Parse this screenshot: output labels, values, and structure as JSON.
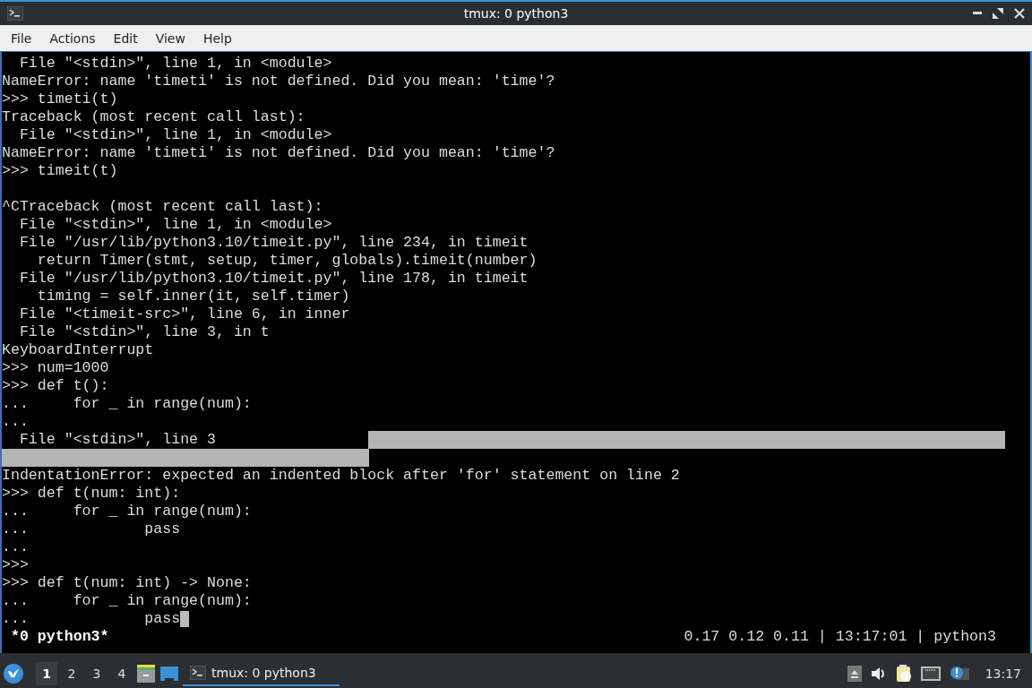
{
  "window": {
    "title": "tmux: 0 python3"
  },
  "menu": [
    "File",
    "Actions",
    "Edit",
    "View",
    "Help"
  ],
  "terminal": {
    "lines": [
      {
        "kind": "text",
        "text": "  File \"<stdin>\", line 1, in <module>"
      },
      {
        "kind": "text",
        "text": "NameError: name 'timeti' is not defined. Did you mean: 'time'?"
      },
      {
        "kind": "text",
        "text": ">>> timeti(t)"
      },
      {
        "kind": "text",
        "text": "Traceback (most recent call last):"
      },
      {
        "kind": "text",
        "text": "  File \"<stdin>\", line 1, in <module>"
      },
      {
        "kind": "text",
        "text": "NameError: name 'timeti' is not defined. Did you mean: 'time'?"
      },
      {
        "kind": "text",
        "text": ">>> timeit(t)"
      },
      {
        "kind": "blank"
      },
      {
        "kind": "text",
        "text": "^CTraceback (most recent call last):"
      },
      {
        "kind": "text",
        "text": "  File \"<stdin>\", line 1, in <module>"
      },
      {
        "kind": "text",
        "text": "  File \"/usr/lib/python3.10/timeit.py\", line 234, in timeit"
      },
      {
        "kind": "text",
        "text": "    return Timer(stmt, setup, timer, globals).timeit(number)"
      },
      {
        "kind": "text",
        "text": "  File \"/usr/lib/python3.10/timeit.py\", line 178, in timeit"
      },
      {
        "kind": "text",
        "text": "    timing = self.inner(it, self.timer)"
      },
      {
        "kind": "text",
        "text": "  File \"<timeit-src>\", line 6, in inner"
      },
      {
        "kind": "text",
        "text": "  File \"<stdin>\", line 3, in t"
      },
      {
        "kind": "text",
        "text": "KeyboardInterrupt"
      },
      {
        "kind": "text",
        "text": ">>> num=1000"
      },
      {
        "kind": "text",
        "text": ">>> def t():"
      },
      {
        "kind": "text",
        "text": "...     for _ in range(num):"
      },
      {
        "kind": "text",
        "text": "..."
      },
      {
        "kind": "selection-tail",
        "text": "  File \"<stdin>\", line 3"
      },
      {
        "kind": "selection-head"
      },
      {
        "kind": "text",
        "text": "IndentationError: expected an indented block after 'for' statement on line 2"
      },
      {
        "kind": "text",
        "text": ">>> def t(num: int):"
      },
      {
        "kind": "text",
        "text": "...     for _ in range(num):"
      },
      {
        "kind": "text",
        "text": "...             pass"
      },
      {
        "kind": "text",
        "text": "..."
      },
      {
        "kind": "text",
        "text": ">>>"
      },
      {
        "kind": "text",
        "text": ">>> def t(num: int) -> None:"
      },
      {
        "kind": "text",
        "text": "...     for _ in range(num):"
      },
      {
        "kind": "cursor",
        "text": "...             pass"
      }
    ],
    "status_left": "*0 python3*",
    "status_right": "0.17 0.12 0.11 | 13:17:01 | python3"
  },
  "taskbar": {
    "workspaces": [
      {
        "label": "1",
        "selected": true
      },
      {
        "label": "2",
        "selected": false
      },
      {
        "label": "3",
        "selected": false
      },
      {
        "label": "4",
        "selected": false
      }
    ],
    "task": {
      "label": "tmux: 0 python3",
      "selected": true
    },
    "clock": "13:17"
  }
}
